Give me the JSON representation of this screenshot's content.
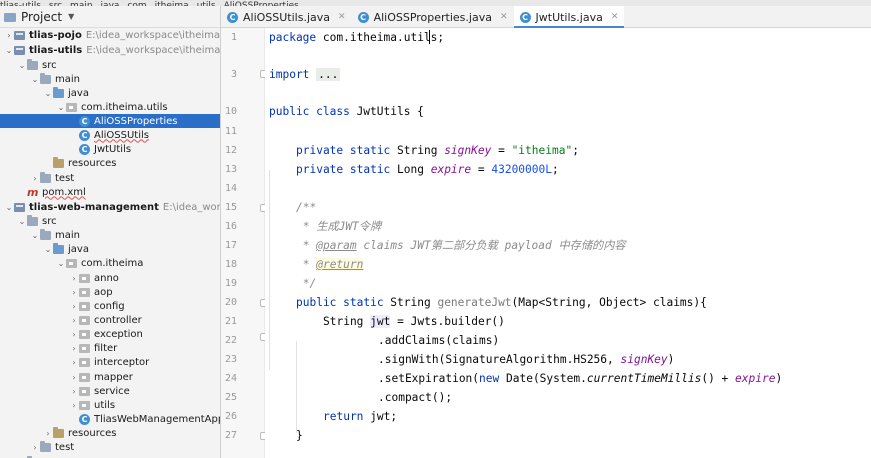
{
  "breadcrumb": [
    "tlias-utils",
    "src",
    "main",
    "java",
    "com",
    "itheima",
    "utils",
    "AliOSSProperties"
  ],
  "project_panel": {
    "title": "Project"
  },
  "tree": [
    {
      "label": "tlias-pojo",
      "path": "E:\\idea_workspace\\itheima_maven_",
      "icon": "module-icon",
      "arrow": "collapsed",
      "bold": true
    },
    {
      "label": "tlias-utils",
      "path": "E:\\idea_workspace\\itheima_maven_p",
      "icon": "module-icon",
      "arrow": "expanded",
      "bold": true
    },
    {
      "label": "src",
      "icon": "folder-icon",
      "arrow": "expanded"
    },
    {
      "label": "main",
      "icon": "folder-icon",
      "arrow": "expanded"
    },
    {
      "label": "java",
      "icon": "source-folder-icon",
      "arrow": "expanded"
    },
    {
      "label": "com.itheima.utils",
      "icon": "package-icon",
      "arrow": "expanded"
    },
    {
      "label": "AliOSSProperties",
      "icon": "class-icon",
      "arrow": "none",
      "selected": true
    },
    {
      "label": "AliOSSUtils",
      "icon": "class-icon",
      "arrow": "none"
    },
    {
      "label": "JwtUtils",
      "icon": "class-icon",
      "arrow": "none"
    },
    {
      "label": "resources",
      "icon": "resources-folder-icon",
      "arrow": "none"
    },
    {
      "label": "test",
      "icon": "folder-icon",
      "arrow": "collapsed"
    },
    {
      "label": "pom.xml",
      "icon": "maven-icon",
      "arrow": "none"
    },
    {
      "label": "tlias-web-management",
      "path": "E:\\idea_workspace\\it",
      "icon": "module-icon",
      "arrow": "expanded",
      "bold": true
    },
    {
      "label": "src",
      "icon": "folder-icon",
      "arrow": "expanded"
    },
    {
      "label": "main",
      "icon": "folder-icon",
      "arrow": "expanded"
    },
    {
      "label": "java",
      "icon": "source-folder-icon",
      "arrow": "expanded"
    },
    {
      "label": "com.itheima",
      "icon": "package-icon",
      "arrow": "expanded"
    },
    {
      "label": "anno",
      "icon": "package-icon",
      "arrow": "collapsed"
    },
    {
      "label": "aop",
      "icon": "package-icon",
      "arrow": "collapsed"
    },
    {
      "label": "config",
      "icon": "package-icon",
      "arrow": "collapsed"
    },
    {
      "label": "controller",
      "icon": "package-icon",
      "arrow": "collapsed"
    },
    {
      "label": "exception",
      "icon": "package-icon",
      "arrow": "collapsed"
    },
    {
      "label": "filter",
      "icon": "package-icon",
      "arrow": "collapsed"
    },
    {
      "label": "interceptor",
      "icon": "package-icon",
      "arrow": "collapsed"
    },
    {
      "label": "mapper",
      "icon": "package-icon",
      "arrow": "collapsed"
    },
    {
      "label": "service",
      "icon": "package-icon",
      "arrow": "collapsed"
    },
    {
      "label": "utils",
      "icon": "package-icon",
      "arrow": "collapsed"
    },
    {
      "label": "TliasWebManagementApplicat",
      "icon": "class-icon",
      "arrow": "none"
    },
    {
      "label": "resources",
      "icon": "resources-folder-icon",
      "arrow": "collapsed"
    },
    {
      "label": "test",
      "icon": "folder-icon",
      "arrow": "collapsed"
    },
    {
      "label": "target",
      "icon": "folder-icon",
      "arrow": "collapsed"
    }
  ],
  "tabs": [
    {
      "label": "AliOSSUtils.java",
      "icon": "class-icon",
      "active": false
    },
    {
      "label": "AliOSSProperties.java",
      "icon": "class-icon",
      "active": false
    },
    {
      "label": "JwtUtils.java",
      "icon": "class-icon",
      "active": true
    }
  ],
  "code": {
    "line_numbers": [
      "1",
      "3",
      "10",
      "11",
      "12",
      "13",
      "14",
      "15",
      "16",
      "17",
      "18",
      "19",
      "20",
      "21",
      "22",
      "23",
      "24",
      "25",
      "26",
      "27"
    ],
    "l1_kw": "package",
    "l1_rest": " com.itheima.utils;",
    "l3_kw": "import",
    "l3_fold": "...",
    "l10_kw": "public class",
    "l10_name": " JwtUtils {",
    "l12_kw": "private static",
    "l12_type": " String ",
    "l12_field": "signKey",
    "l12_eq": " = ",
    "l12_str": "\"itheima\"",
    "l12_end": ";",
    "l13_kw": "private static",
    "l13_type": " Long ",
    "l13_field": "expire",
    "l13_eq": " = ",
    "l13_num": "43200000L",
    "l13_end": ";",
    "l15": "/**",
    "l16": " * 生成JWT令牌",
    "l17_star": " * ",
    "l17_tag": "@param",
    "l17_rest": " claims JWT第二部分负载 payload 中存储的内容",
    "l18_star": " * ",
    "l18_tag": "@return",
    "l19": " */",
    "l20_kw": "public static",
    "l20_type": " String ",
    "l20_name": "generateJwt",
    "l20_rest": "(Map<String, Object> claims){",
    "l21_type": "String ",
    "l21_var": "jwt",
    "l21_eq": " = ",
    "l21_cls": "Jwts",
    "l21_rest": ".builder()",
    "l22": ".addClaims(claims)",
    "l23_a": ".signWith(",
    "l23_cls": "SignatureAlgorithm",
    "l23_b": ".HS256, ",
    "l23_field": "signKey",
    "l23_c": ")",
    "l24_a": ".setExpiration(",
    "l24_kw": "new",
    "l24_b": " Date(System.",
    "l24_m": "currentTimeMillis",
    "l24_c": "() + ",
    "l24_field": "expire",
    "l24_d": ")",
    "l25": ".compact();",
    "l26_kw": "return",
    "l26_rest": " jwt;",
    "l27": "}"
  }
}
